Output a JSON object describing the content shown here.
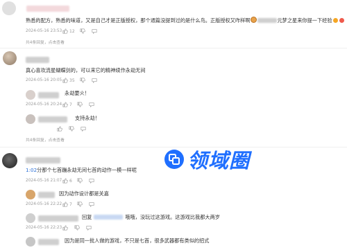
{
  "comments": [
    {
      "text": "熟悉的配方，熟悉的味道，又是自己才是正版授权，那个通篇没提到过的是什么鸟。正版授权又咋样啊",
      "text_tail": "元梦之星来你提一下经验",
      "time": "2024-05-16 23:53",
      "like_count": "12",
      "replies": "共4条回复，点击查看"
    },
    {
      "text": "真心喜欢流星蝴蝶剑的，可以来它的精神续作永劫无间",
      "time": "2024-05-16 20:05",
      "like_count": "35",
      "replies": "共4条回复，点击查看",
      "sub_replies": [
        {
          "text": "永劫要火！",
          "time": "2024-05-16 20:24",
          "like_count": "7"
        },
        {
          "text": "支持永劫！",
          "time": "",
          "like_count": ""
        }
      ]
    },
    {
      "time_link": "1:02",
      "text": "分那个七首蹦永劫无间七首的动作一模一样呢",
      "time": "2024-05-16 21:07",
      "like_count": "6",
      "sub_replies": [
        {
          "text": "因为动作设计都是关嘉",
          "time": "2024-05-16 22:22",
          "like_count": "7"
        },
        {
          "prefix": "回复",
          "text": "哦哦，没玩过这游戏。这游戏比我都大两岁",
          "time": "2024-05-16 22:23",
          "like_count": ""
        },
        {
          "text": "因为是同一批人做的游戏，不只是七首，很多武器都有类似的招式",
          "time": "",
          "like_count": ""
        }
      ]
    }
  ],
  "watermark": {
    "text": "领域圈"
  },
  "colors": {
    "accent": "#1f6fff",
    "link": "#2a6fd6",
    "meta": "#9a9a9a"
  }
}
